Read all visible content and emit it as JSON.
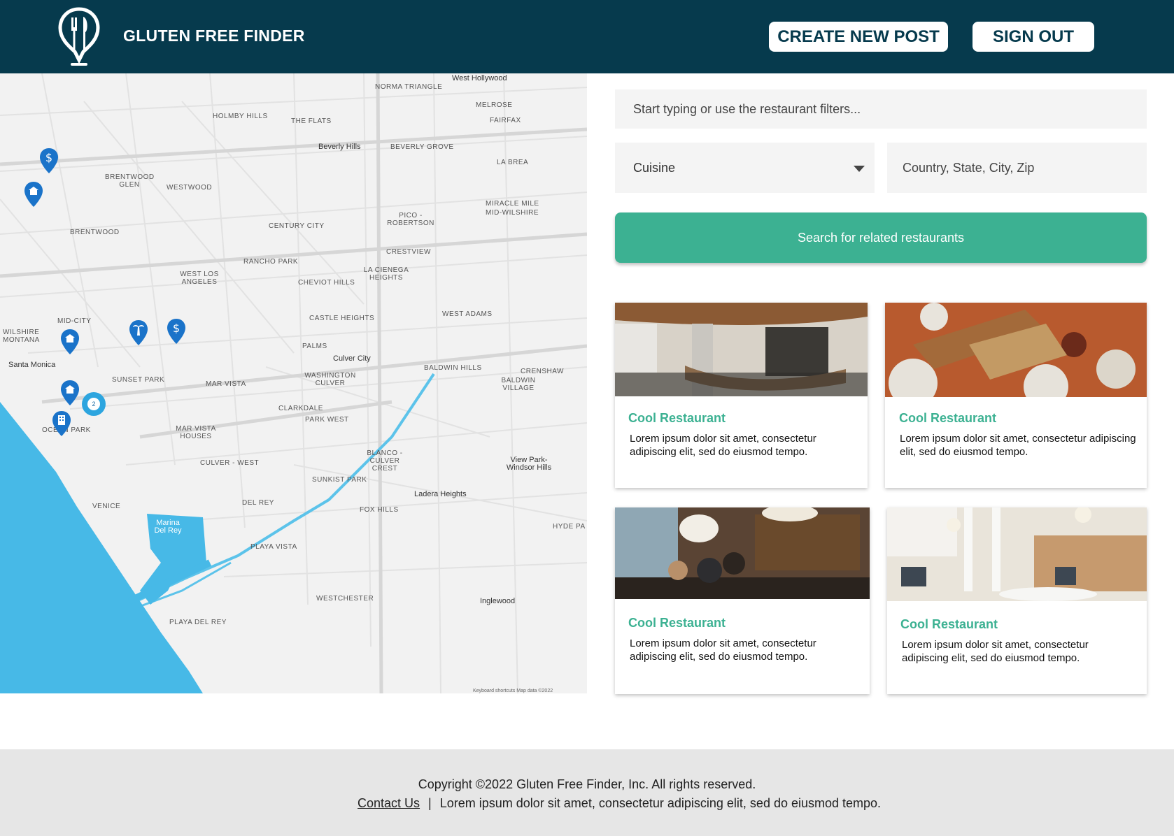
{
  "header": {
    "brand": "GLUTEN FREE FINDER",
    "create_label": "CREATE NEW POST",
    "signout_label": "SIGN OUT",
    "bg_color": "#063a4d"
  },
  "map": {
    "labels": [
      "NORMA TRIANGLE",
      "West Hollywood",
      "MELROSE",
      "FAIRFAX",
      "HOLMBY HILLS",
      "THE FLATS",
      "Beverly Hills",
      "BEVERLY GROVE",
      "LA BREA",
      "BRENTWOOD GLEN",
      "WESTWOOD",
      "MIRACLE MILE",
      "MID-WILSHIRE",
      "PICO - ROBERTSON",
      "CENTURY CITY",
      "BRENTWOOD",
      "CRESTVIEW",
      "RANCHO PARK",
      "LA CIENEGA HEIGHTS",
      "WEST LOS ANGELES",
      "CHEVIOT HILLS",
      "MID-CITY",
      "WILSHIRE MONTANA",
      "CASTLE HEIGHTS",
      "WEST ADAMS",
      "PALMS",
      "Culver City",
      "Santa Monica",
      "SUNSET PARK",
      "MAR VISTA",
      "WASHINGTON CULVER",
      "BALDWIN HILLS",
      "CRENSHAW",
      "BALDWIN VILLAGE",
      "OCEAN PARK",
      "CLARKDALE",
      "PARK WEST",
      "MAR VISTA HOUSES",
      "CULVER - WEST",
      "BLANCO - CULVER CREST",
      "View Park-Windsor Hills",
      "SUNKIST PARK",
      "Ladera Heights",
      "DEL REY",
      "VENICE",
      "FOX HILLS",
      "Marina Del Rey",
      "PLAYA VISTA",
      "HYDE PA",
      "WESTCHESTER",
      "Inglewood",
      "PLAYA DEL REY"
    ],
    "attribution": "Keyboard shortcuts   Map data ©2022",
    "cluster_count": "2",
    "pin_color": "#1a73c9",
    "water_color": "#47b9e7"
  },
  "search": {
    "placeholder": "Start typing or use the restaurant filters...",
    "cuisine_label": "Cuisine",
    "location_placeholder": "Country, State, City, Zip",
    "button_label": "Search for related restaurants",
    "accent": "#3cb192"
  },
  "cards": [
    {
      "title": "Cool Restaurant",
      "desc": "Lorem ipsum dolor sit amet, consectetur adipiscing elit, sed do eiusmod tempo."
    },
    {
      "title": "Cool Restaurant",
      "desc": "Lorem ipsum dolor sit amet, consectetur adipiscing elit, sed do eiusmod tempo."
    },
    {
      "title": "Cool Restaurant",
      "desc": "Lorem ipsum dolor sit amet, consectetur adipiscing elit, sed do eiusmod tempo."
    },
    {
      "title": "Cool Restaurant",
      "desc": "Lorem ipsum dolor sit amet, consectetur adipiscing elit, sed do eiusmod tempo."
    }
  ],
  "footer": {
    "copyright": "Copyright ©2022 Gluten Free Finder, Inc. All rights reserved.",
    "contact_label": "Contact Us",
    "text": "Lorem ipsum dolor sit amet, consectetur adipiscing elit, sed do eiusmod tempo."
  }
}
